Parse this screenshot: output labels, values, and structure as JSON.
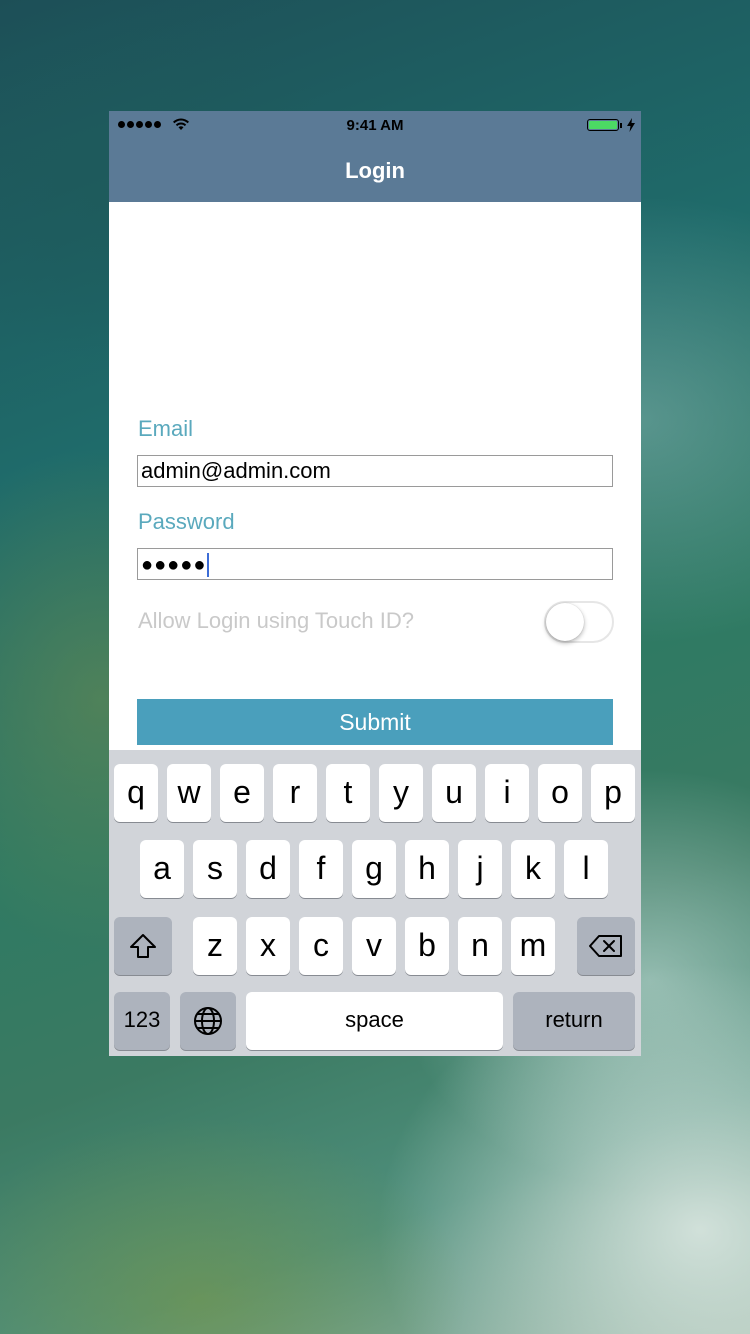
{
  "status_bar": {
    "time": "9:41 AM"
  },
  "nav": {
    "title": "Login"
  },
  "form": {
    "email_label": "Email",
    "email_value": "admin@admin.com",
    "password_label": "Password",
    "password_mask": "●●●●●",
    "touch_id_label": "Allow Login using Touch ID?",
    "touch_id_enabled": false,
    "submit_label": "Submit"
  },
  "keyboard": {
    "row1": [
      "q",
      "w",
      "e",
      "r",
      "t",
      "y",
      "u",
      "i",
      "o",
      "p"
    ],
    "row2": [
      "a",
      "s",
      "d",
      "f",
      "g",
      "h",
      "j",
      "k",
      "l"
    ],
    "row3": [
      "z",
      "x",
      "c",
      "v",
      "b",
      "n",
      "m"
    ],
    "numbers_label": "123",
    "space_label": "space",
    "return_label": "return",
    "icons": {
      "shift": "shift-icon",
      "delete": "delete-icon",
      "globe": "globe-icon"
    }
  },
  "colors": {
    "nav_bar": "#5b7a96",
    "label_accent": "#5aa9bd",
    "submit_button": "#4a9fbc",
    "battery": "#4cd964",
    "caret": "#3d6dd6"
  }
}
